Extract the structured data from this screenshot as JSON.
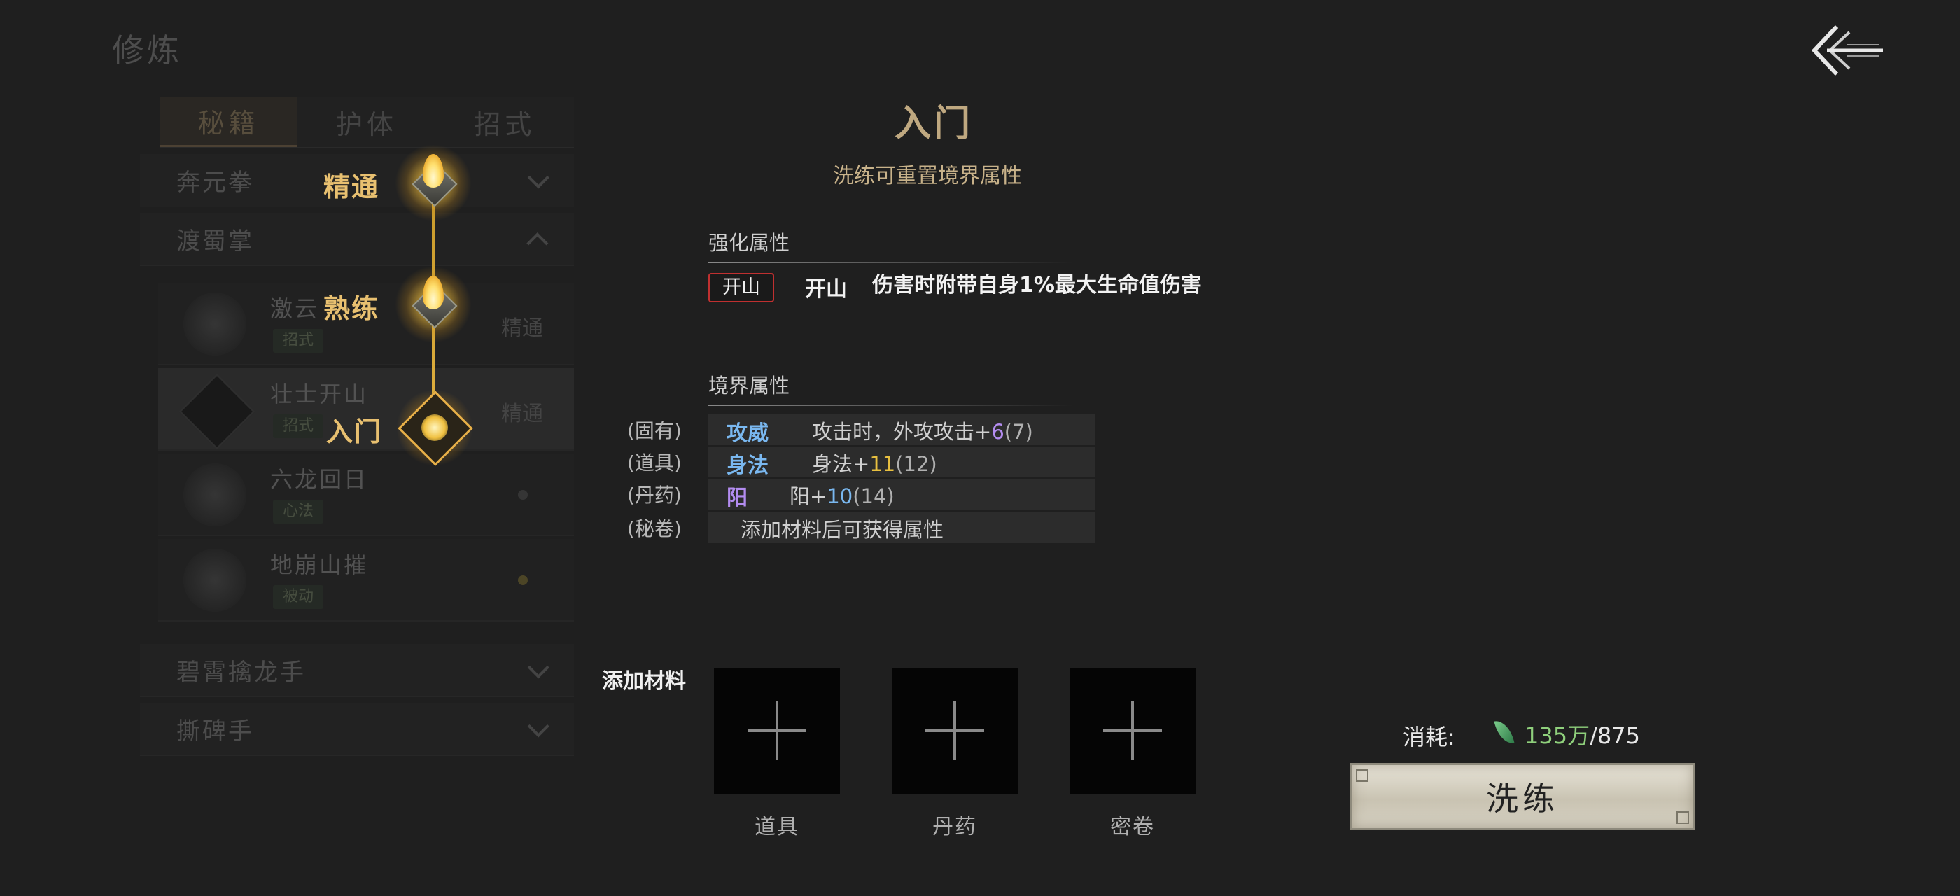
{
  "page": {
    "title": "修炼"
  },
  "tabs": [
    {
      "label": "秘籍",
      "active": true
    },
    {
      "label": "护体",
      "active": false
    },
    {
      "label": "招式",
      "active": false
    }
  ],
  "groups": [
    {
      "label": "奔元拳",
      "expanded": false
    },
    {
      "label": "渡蜀掌",
      "expanded": true
    },
    {
      "label": "碧霄擒龙手",
      "expanded": false
    },
    {
      "label": "撕碑手",
      "expanded": false
    }
  ],
  "skills": [
    {
      "name": "激云",
      "tag": "招式",
      "level": "精通",
      "selected": false
    },
    {
      "name": "壮士开山",
      "tag": "招式",
      "level": "精通",
      "selected": true
    },
    {
      "name": "六龙回日",
      "tag": "心法",
      "level": "",
      "selected": false
    },
    {
      "name": "地崩山摧",
      "tag": "被动",
      "level": "",
      "selected": false
    }
  ],
  "ladder": [
    {
      "label": "精通",
      "state": "unlocked"
    },
    {
      "label": "熟练",
      "state": "unlocked"
    },
    {
      "label": "入门",
      "state": "current"
    }
  ],
  "detail": {
    "title": "入门",
    "subtitle": "洗练可重置境界属性",
    "enhance_header": "强化属性",
    "enhance_badge": "开山",
    "enhance_name": "开山",
    "enhance_desc": "伤害时附带自身1%最大生命值伤害",
    "realm_header": "境界属性",
    "attributes": [
      {
        "source": "(固有)",
        "name": "攻威",
        "name_color": "#7ab8f0",
        "prefix": "攻击时，外攻攻击+",
        "bonus": "6",
        "base": "(7)",
        "bonus_color": "#b38cf0"
      },
      {
        "source": "(道具)",
        "name": "身法",
        "name_color": "#7ab8f0",
        "prefix": "身法+",
        "bonus": "11",
        "base": "(12)",
        "bonus_color": "#e8c040"
      },
      {
        "source": "(丹药)",
        "name": "阳",
        "name_color": "#b38cf0",
        "prefix": "阳+",
        "bonus": "10",
        "base": "(14)",
        "bonus_color": "#7ab8f0"
      },
      {
        "source": "(秘卷)",
        "name": "",
        "name_color": "#d0d0d0",
        "prefix": "添加材料后可获得属性",
        "bonus": "",
        "base": "",
        "bonus_color": "#d0d0d0"
      }
    ]
  },
  "materials": {
    "label": "添加材料",
    "slots": [
      {
        "caption": "道具",
        "icon": "plus-icon"
      },
      {
        "caption": "丹药",
        "icon": "plus-icon"
      },
      {
        "caption": "密卷",
        "icon": "plus-icon"
      }
    ]
  },
  "cost": {
    "label": "消耗:",
    "icon": "leaf-icon",
    "have": "135万",
    "need": "/875"
  },
  "refine_button": {
    "label": "洗练"
  },
  "back_icon": "back-arrow-icon"
}
